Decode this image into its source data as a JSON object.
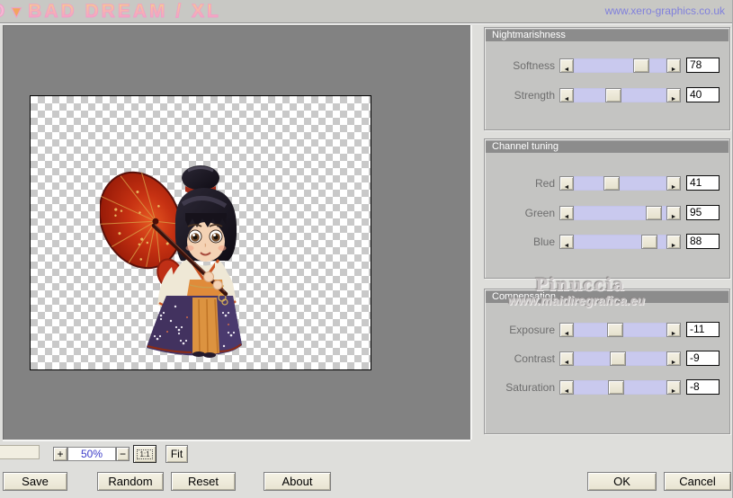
{
  "titlebar": {
    "logo_cut": "O",
    "logo_marker": "▼",
    "title": "BAD DREAM / XL",
    "website": "www.xero-graphics.co.uk"
  },
  "preview_controls": {
    "zoom_in": "+",
    "zoom_level": "50%",
    "zoom_out": "−",
    "actual_size": "1:1",
    "fit": "Fit"
  },
  "panels": [
    {
      "title": "Nightmarishness",
      "sliders": [
        {
          "label": "Softness",
          "value": "78",
          "fraction": 0.78
        },
        {
          "label": "Strength",
          "value": "40",
          "fraction": 0.41
        }
      ]
    },
    {
      "title": "Channel tuning",
      "sliders": [
        {
          "label": "Red",
          "value": "41",
          "fraction": 0.39
        },
        {
          "label": "Green",
          "value": "95",
          "fraction": 0.94
        },
        {
          "label": "Blue",
          "value": "88",
          "fraction": 0.88
        }
      ]
    },
    {
      "title": "Compensation",
      "sliders": [
        {
          "label": "Exposure",
          "value": "-11",
          "fraction": 0.43
        },
        {
          "label": "Contrast",
          "value": "-9",
          "fraction": 0.47
        },
        {
          "label": "Saturation",
          "value": "-8",
          "fraction": 0.45
        }
      ]
    }
  ],
  "watermark": {
    "name": "Pinuccia",
    "url": "www.maidiregrafica.eu"
  },
  "buttons": {
    "save": "Save",
    "random": "Random",
    "reset": "Reset",
    "about": "About",
    "ok": "OK",
    "cancel": "Cancel"
  },
  "colors": {
    "slider_track": "#c9c9ee",
    "panel_header": "#8c8c8c",
    "preview_background": "#828282",
    "title_gradient_top": "#f6c795",
    "title_gradient_bottom": "#f5a3c8",
    "website_link": "#8080dc",
    "zoom_level_text": "#3b3bc8"
  }
}
